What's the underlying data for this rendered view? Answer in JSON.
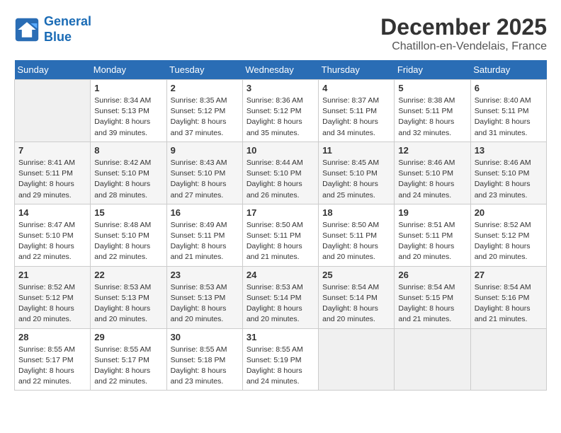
{
  "header": {
    "logo_line1": "General",
    "logo_line2": "Blue",
    "month": "December 2025",
    "location": "Chatillon-en-Vendelais, France"
  },
  "weekdays": [
    "Sunday",
    "Monday",
    "Tuesday",
    "Wednesday",
    "Thursday",
    "Friday",
    "Saturday"
  ],
  "weeks": [
    [
      {
        "day": "",
        "info": ""
      },
      {
        "day": "1",
        "info": "Sunrise: 8:34 AM\nSunset: 5:13 PM\nDaylight: 8 hours\nand 39 minutes."
      },
      {
        "day": "2",
        "info": "Sunrise: 8:35 AM\nSunset: 5:12 PM\nDaylight: 8 hours\nand 37 minutes."
      },
      {
        "day": "3",
        "info": "Sunrise: 8:36 AM\nSunset: 5:12 PM\nDaylight: 8 hours\nand 35 minutes."
      },
      {
        "day": "4",
        "info": "Sunrise: 8:37 AM\nSunset: 5:11 PM\nDaylight: 8 hours\nand 34 minutes."
      },
      {
        "day": "5",
        "info": "Sunrise: 8:38 AM\nSunset: 5:11 PM\nDaylight: 8 hours\nand 32 minutes."
      },
      {
        "day": "6",
        "info": "Sunrise: 8:40 AM\nSunset: 5:11 PM\nDaylight: 8 hours\nand 31 minutes."
      }
    ],
    [
      {
        "day": "7",
        "info": "Sunrise: 8:41 AM\nSunset: 5:11 PM\nDaylight: 8 hours\nand 29 minutes."
      },
      {
        "day": "8",
        "info": "Sunrise: 8:42 AM\nSunset: 5:10 PM\nDaylight: 8 hours\nand 28 minutes."
      },
      {
        "day": "9",
        "info": "Sunrise: 8:43 AM\nSunset: 5:10 PM\nDaylight: 8 hours\nand 27 minutes."
      },
      {
        "day": "10",
        "info": "Sunrise: 8:44 AM\nSunset: 5:10 PM\nDaylight: 8 hours\nand 26 minutes."
      },
      {
        "day": "11",
        "info": "Sunrise: 8:45 AM\nSunset: 5:10 PM\nDaylight: 8 hours\nand 25 minutes."
      },
      {
        "day": "12",
        "info": "Sunrise: 8:46 AM\nSunset: 5:10 PM\nDaylight: 8 hours\nand 24 minutes."
      },
      {
        "day": "13",
        "info": "Sunrise: 8:46 AM\nSunset: 5:10 PM\nDaylight: 8 hours\nand 23 minutes."
      }
    ],
    [
      {
        "day": "14",
        "info": "Sunrise: 8:47 AM\nSunset: 5:10 PM\nDaylight: 8 hours\nand 22 minutes."
      },
      {
        "day": "15",
        "info": "Sunrise: 8:48 AM\nSunset: 5:10 PM\nDaylight: 8 hours\nand 22 minutes."
      },
      {
        "day": "16",
        "info": "Sunrise: 8:49 AM\nSunset: 5:11 PM\nDaylight: 8 hours\nand 21 minutes."
      },
      {
        "day": "17",
        "info": "Sunrise: 8:50 AM\nSunset: 5:11 PM\nDaylight: 8 hours\nand 21 minutes."
      },
      {
        "day": "18",
        "info": "Sunrise: 8:50 AM\nSunset: 5:11 PM\nDaylight: 8 hours\nand 20 minutes."
      },
      {
        "day": "19",
        "info": "Sunrise: 8:51 AM\nSunset: 5:11 PM\nDaylight: 8 hours\nand 20 minutes."
      },
      {
        "day": "20",
        "info": "Sunrise: 8:52 AM\nSunset: 5:12 PM\nDaylight: 8 hours\nand 20 minutes."
      }
    ],
    [
      {
        "day": "21",
        "info": "Sunrise: 8:52 AM\nSunset: 5:12 PM\nDaylight: 8 hours\nand 20 minutes."
      },
      {
        "day": "22",
        "info": "Sunrise: 8:53 AM\nSunset: 5:13 PM\nDaylight: 8 hours\nand 20 minutes."
      },
      {
        "day": "23",
        "info": "Sunrise: 8:53 AM\nSunset: 5:13 PM\nDaylight: 8 hours\nand 20 minutes."
      },
      {
        "day": "24",
        "info": "Sunrise: 8:53 AM\nSunset: 5:14 PM\nDaylight: 8 hours\nand 20 minutes."
      },
      {
        "day": "25",
        "info": "Sunrise: 8:54 AM\nSunset: 5:14 PM\nDaylight: 8 hours\nand 20 minutes."
      },
      {
        "day": "26",
        "info": "Sunrise: 8:54 AM\nSunset: 5:15 PM\nDaylight: 8 hours\nand 21 minutes."
      },
      {
        "day": "27",
        "info": "Sunrise: 8:54 AM\nSunset: 5:16 PM\nDaylight: 8 hours\nand 21 minutes."
      }
    ],
    [
      {
        "day": "28",
        "info": "Sunrise: 8:55 AM\nSunset: 5:17 PM\nDaylight: 8 hours\nand 22 minutes."
      },
      {
        "day": "29",
        "info": "Sunrise: 8:55 AM\nSunset: 5:17 PM\nDaylight: 8 hours\nand 22 minutes."
      },
      {
        "day": "30",
        "info": "Sunrise: 8:55 AM\nSunset: 5:18 PM\nDaylight: 8 hours\nand 23 minutes."
      },
      {
        "day": "31",
        "info": "Sunrise: 8:55 AM\nSunset: 5:19 PM\nDaylight: 8 hours\nand 24 minutes."
      },
      {
        "day": "",
        "info": ""
      },
      {
        "day": "",
        "info": ""
      },
      {
        "day": "",
        "info": ""
      }
    ]
  ]
}
